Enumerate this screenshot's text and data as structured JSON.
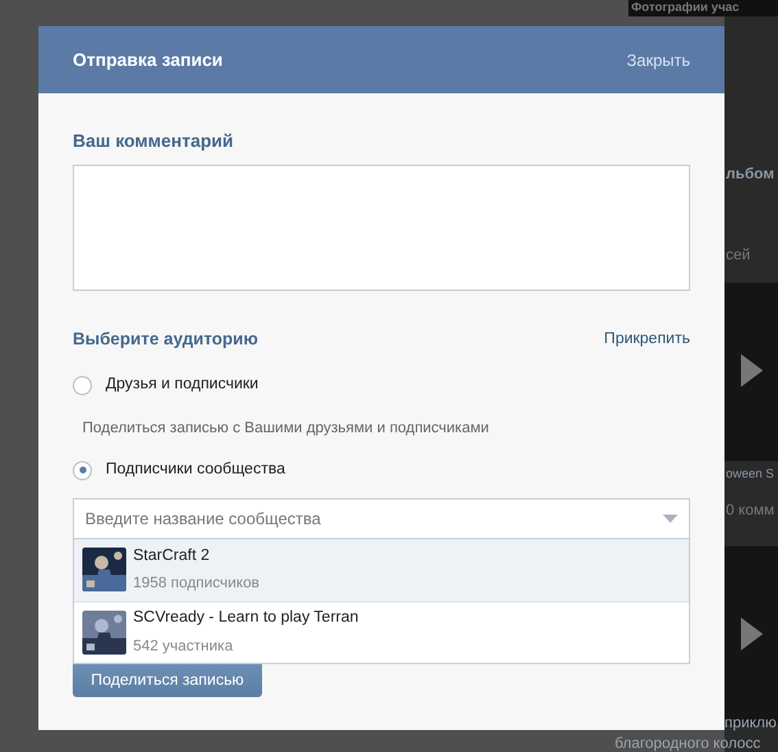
{
  "background_page": {
    "texts": [
      {
        "kind": "caption",
        "text": "Фотографии учас"
      },
      {
        "kind": "title",
        "text": "льбом"
      },
      {
        "kind": "meta",
        "text": "сей"
      },
      {
        "kind": "video"
      },
      {
        "kind": "title",
        "text": "oween S"
      },
      {
        "kind": "meta",
        "text": "0 комм"
      },
      {
        "kind": "video"
      },
      {
        "kind": "title",
        "text": "приклю"
      },
      {
        "kind": "title",
        "text": "благородного колосс"
      }
    ]
  },
  "dialog": {
    "title": "Отправка записи",
    "close_link": "Закрыть",
    "comment": {
      "label": "Ваш комментарий"
    },
    "audience": {
      "label": "Выберите аудиторию",
      "attach_link": "Прикрепить",
      "options": [
        {
          "label": "Друзья и подписчики",
          "selected": false,
          "description": "Поделиться записью с Вашими друзьями и подписчиками"
        },
        {
          "label": "Подписчики сообщества",
          "selected": true
        }
      ]
    },
    "community_search": {
      "placeholder": "Введите название сообщества"
    },
    "suggestions": [
      {
        "name": "StarCraft 2",
        "members": "1958 подписчиков",
        "selected": true
      },
      {
        "name": "SCVready - Learn to play Terran",
        "members": "542 участника",
        "selected": false
      }
    ],
    "share_button": "Поделиться записью"
  }
}
